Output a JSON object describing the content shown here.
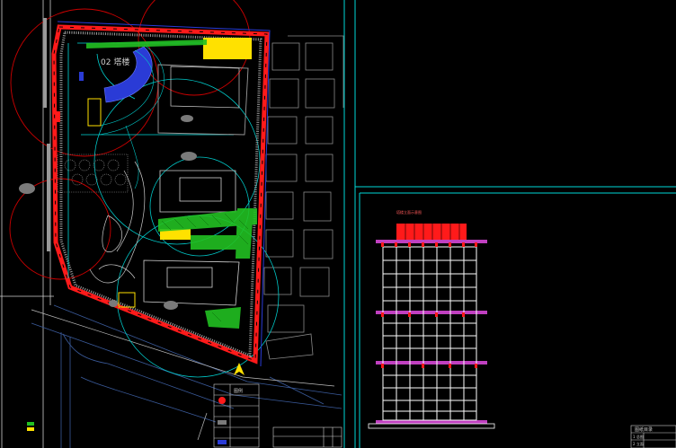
{
  "viewport_label": "02 塔楼",
  "plan_table_title": "图例",
  "elevation_label": "塔楼立面示意图",
  "title_block_header": "图纸目录",
  "title_block_rows": [
    "1 总图",
    "2 立面"
  ],
  "colors": {
    "background": "#000000",
    "frame": "#00d8d8",
    "site_boundary": "#ff0000",
    "cad_lines": "#ffffff",
    "fire_circles": "#cc0000",
    "lift_zone": "#2a3bd6",
    "label_yellow": "#ffe100",
    "hatch_green": "#22c022",
    "slab_magenta": "#c040c0",
    "building_grey": "#7a7a7a",
    "road_blue": "#3a5a9a"
  }
}
